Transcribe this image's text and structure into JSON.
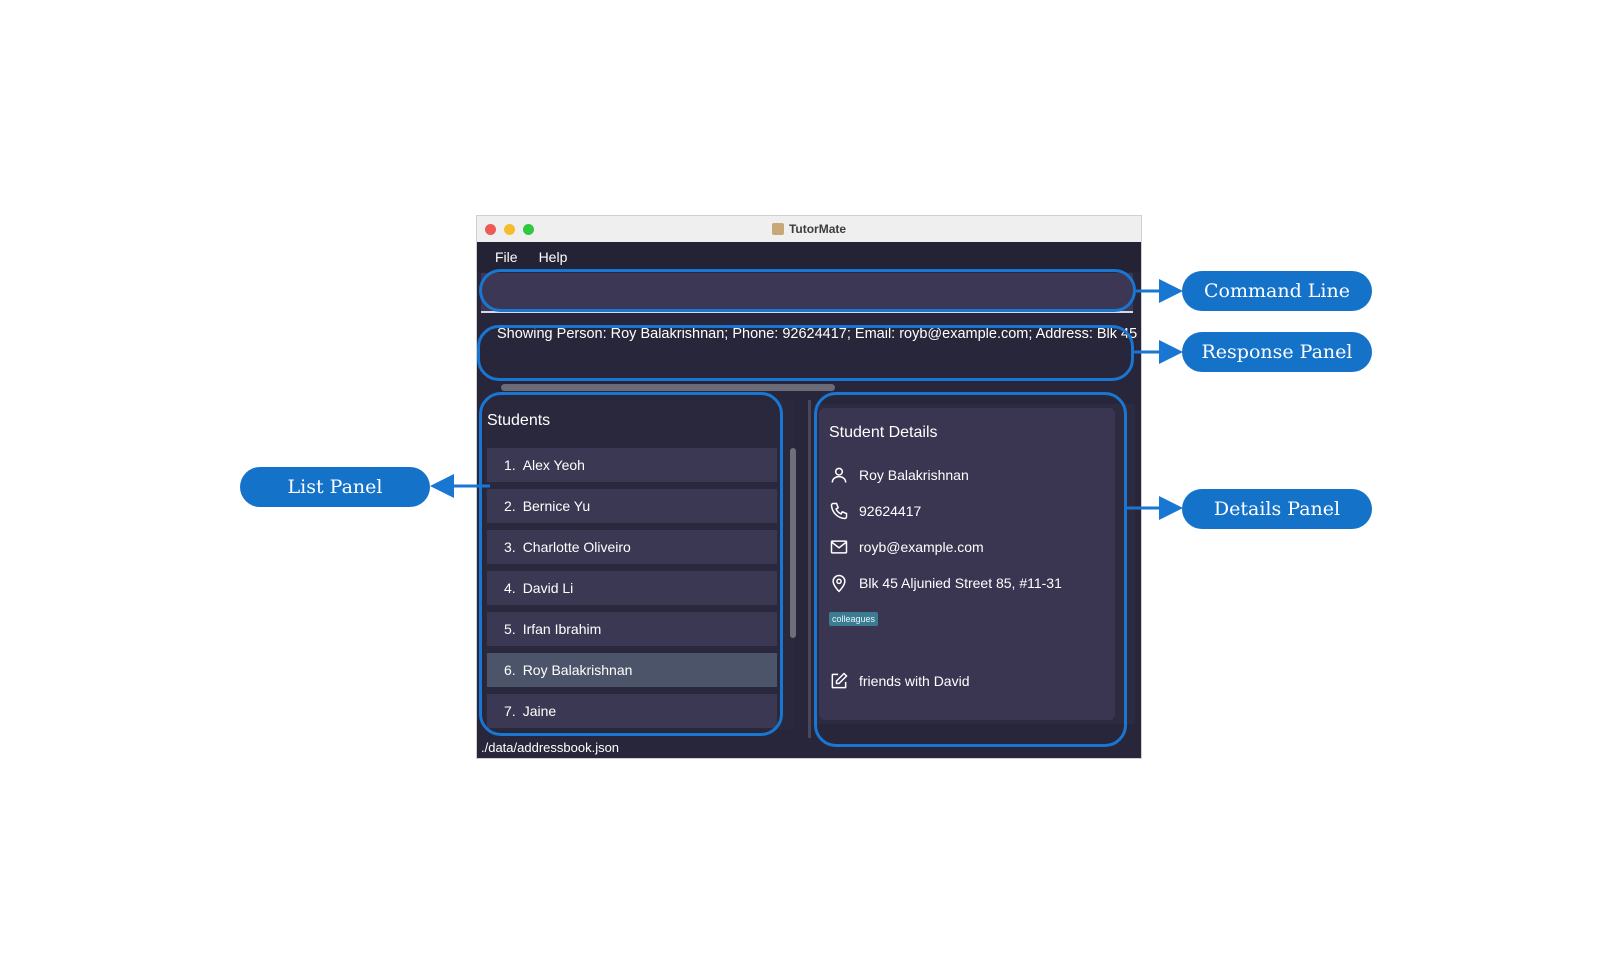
{
  "window": {
    "title": "TutorMate"
  },
  "menu": [
    "File",
    "Help"
  ],
  "command": {
    "value": "",
    "placeholder": ""
  },
  "response": {
    "text": "Showing Person: Roy Balakrishnan; Phone: 92624417; Email: royb@example.com; Address: Blk 45"
  },
  "list_panel": {
    "title": "Students",
    "items": [
      {
        "index": "1.",
        "name": "Alex Yeoh"
      },
      {
        "index": "2.",
        "name": "Bernice Yu"
      },
      {
        "index": "3.",
        "name": "Charlotte Oliveiro"
      },
      {
        "index": "4.",
        "name": "David Li"
      },
      {
        "index": "5.",
        "name": "Irfan Ibrahim"
      },
      {
        "index": "6.",
        "name": "Roy Balakrishnan",
        "selected": true
      },
      {
        "index": "7.",
        "name": "Jaine"
      }
    ]
  },
  "details": {
    "title": "Student Details",
    "name": "Roy Balakrishnan",
    "phone": "92624417",
    "email": "royb@example.com",
    "address": "Blk 45 Aljunied Street 85, #11-31",
    "tag": "colleagues",
    "remark": "friends with David",
    "icons": [
      "person-icon",
      "phone-icon",
      "email-icon",
      "location-icon",
      "edit-icon"
    ]
  },
  "status": {
    "path": "./data/addressbook.json"
  },
  "annotations": {
    "command_line": "Command Line",
    "response_panel": "Response Panel",
    "list_panel": "List Panel",
    "details_panel": "Details Panel",
    "color": "#1472c8"
  }
}
